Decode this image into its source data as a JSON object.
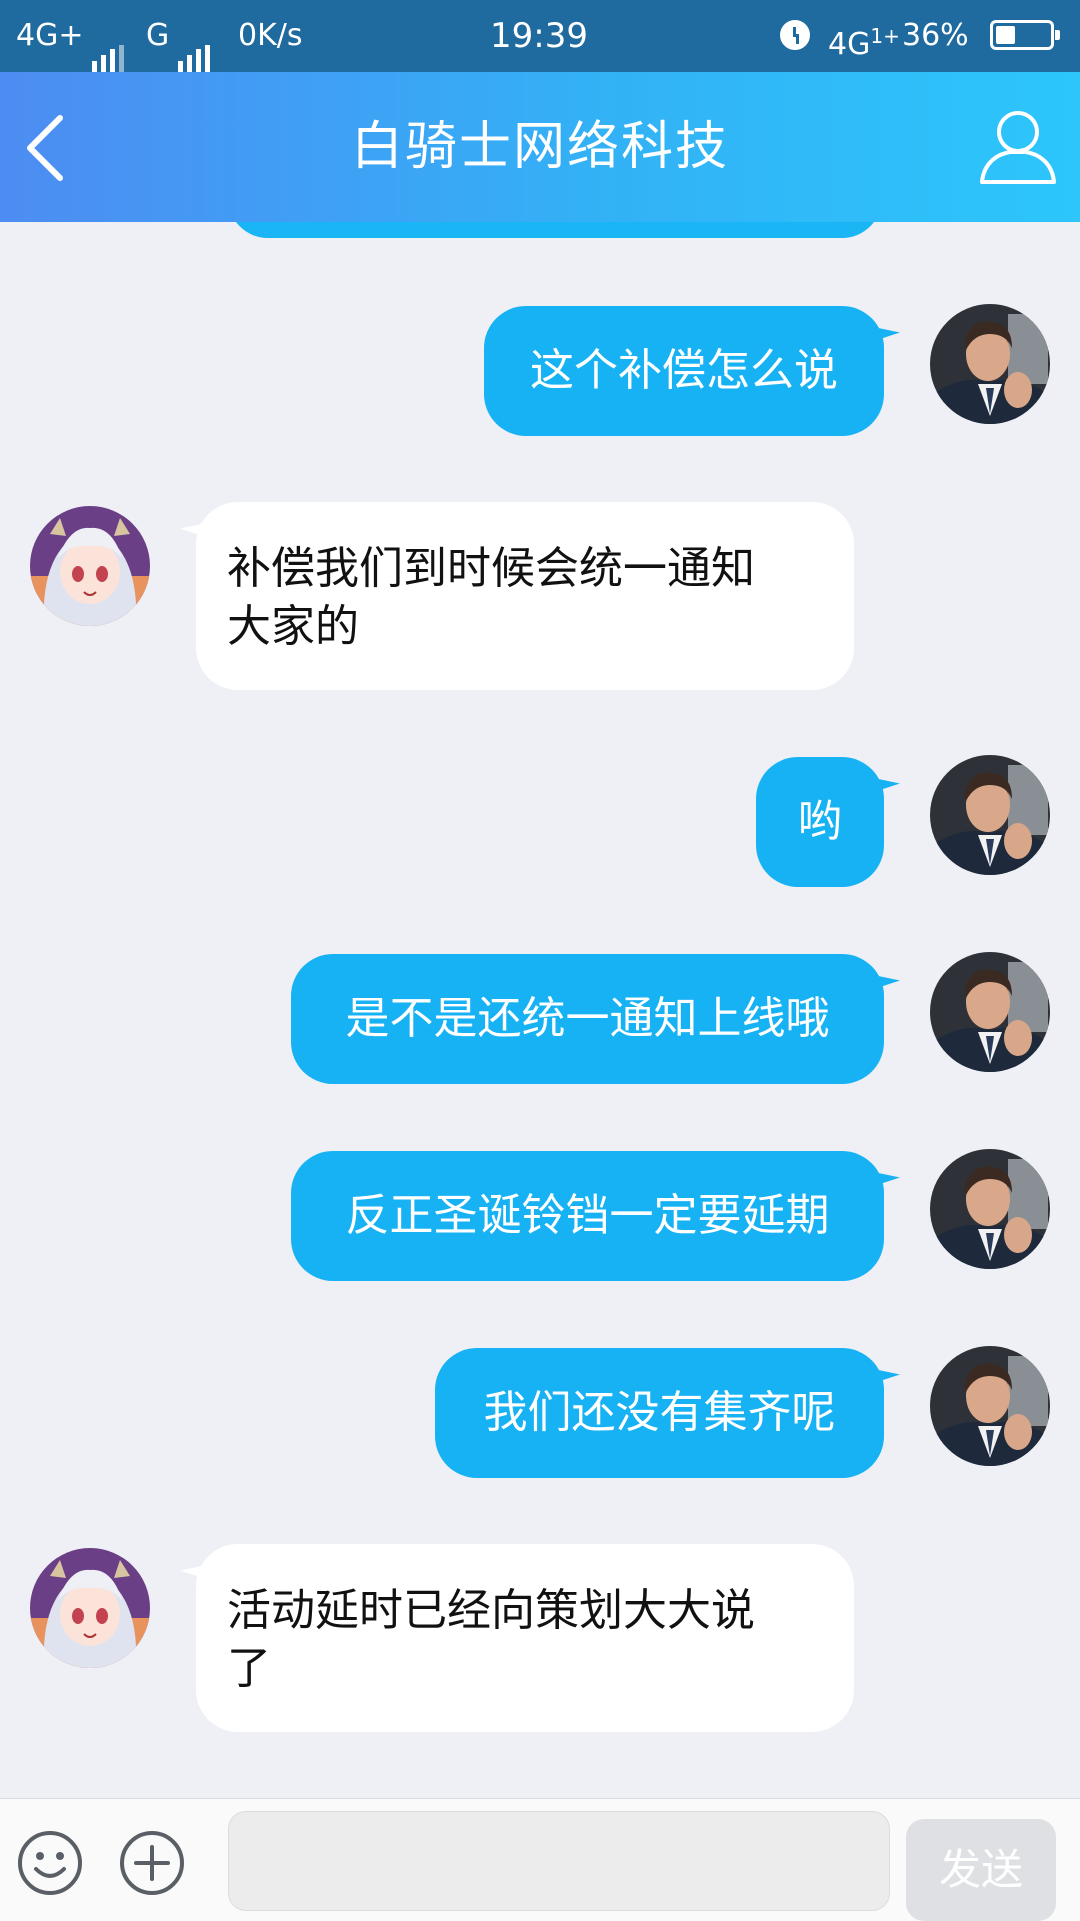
{
  "status_bar": {
    "network1": "4G+",
    "network2": "G",
    "speed": "0K/s",
    "time": "19:39",
    "network3": "4G",
    "battery": "36%",
    "battery_level": 0.36
  },
  "header": {
    "title": "白骑士网络科技",
    "back_icon": "chevron-left-icon",
    "profile_icon": "person-outline-icon"
  },
  "colors": {
    "header_gradient_start": "#4d8cf2",
    "header_gradient_end": "#2cc6fb",
    "outgoing_bubble": "#16b2f3",
    "incoming_bubble": "#ffffff",
    "chat_background": "#eef0f6"
  },
  "messages": [
    {
      "side": "out",
      "lines": [
        "这个补偿怎么说"
      ]
    },
    {
      "side": "in",
      "lines": [
        "补偿我们到时候会统一通知",
        "大家的"
      ]
    },
    {
      "side": "out",
      "lines": [
        "哟"
      ]
    },
    {
      "side": "out",
      "lines": [
        "是不是还统一通知上线哦"
      ]
    },
    {
      "side": "out",
      "lines": [
        "反正圣诞铃铛一定要延期"
      ]
    },
    {
      "side": "out",
      "lines": [
        "我们还没有集齐呢"
      ]
    },
    {
      "side": "in",
      "lines": [
        "活动延时已经向策划大大说",
        "了"
      ]
    }
  ],
  "input_bar": {
    "emoji_icon": "smiley-icon",
    "plus_icon": "plus-circle-icon",
    "placeholder": "",
    "send_label": "发送"
  }
}
